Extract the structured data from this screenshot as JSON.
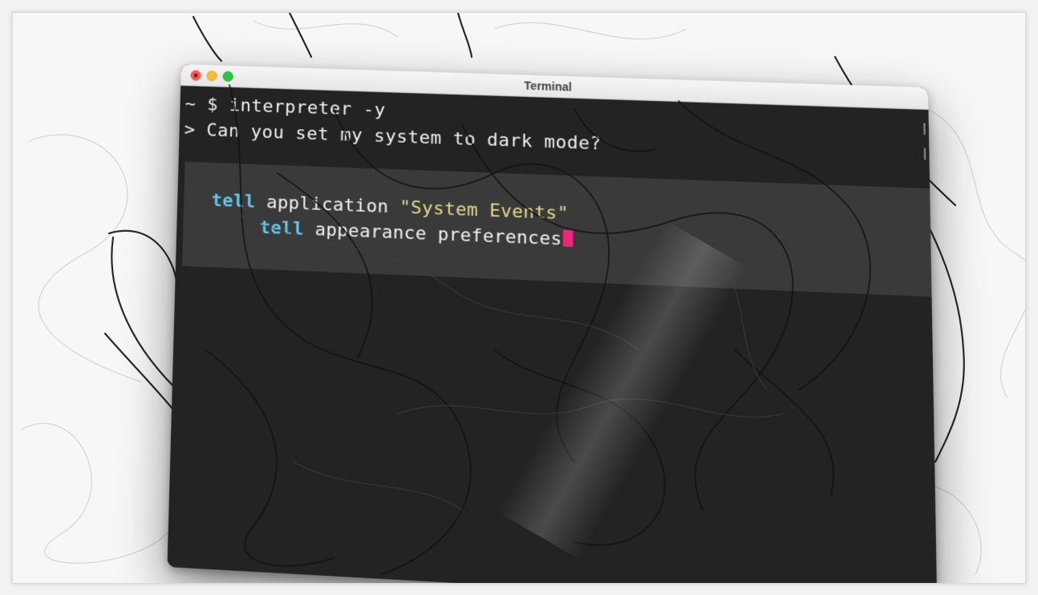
{
  "window": {
    "title": "Terminal",
    "controls": {
      "close": "close-icon",
      "minimize": "minimize-icon",
      "zoom": "zoom-icon"
    }
  },
  "terminal": {
    "prompt_line": "~ $ interpreter -y",
    "user_message": "> Can you set my system to dark mode?",
    "code_block": {
      "line1": {
        "keyword": "tell",
        "text": " application ",
        "string": "\"System Events\""
      },
      "line2": {
        "keyword": "tell",
        "text": " appearance preferences"
      }
    },
    "cursor_color": "#f0247a"
  },
  "colors": {
    "keyword": "#5fc6ec",
    "string": "#e6d98a",
    "terminal_bg": "#232323",
    "code_bg": "#3a3a3a"
  }
}
